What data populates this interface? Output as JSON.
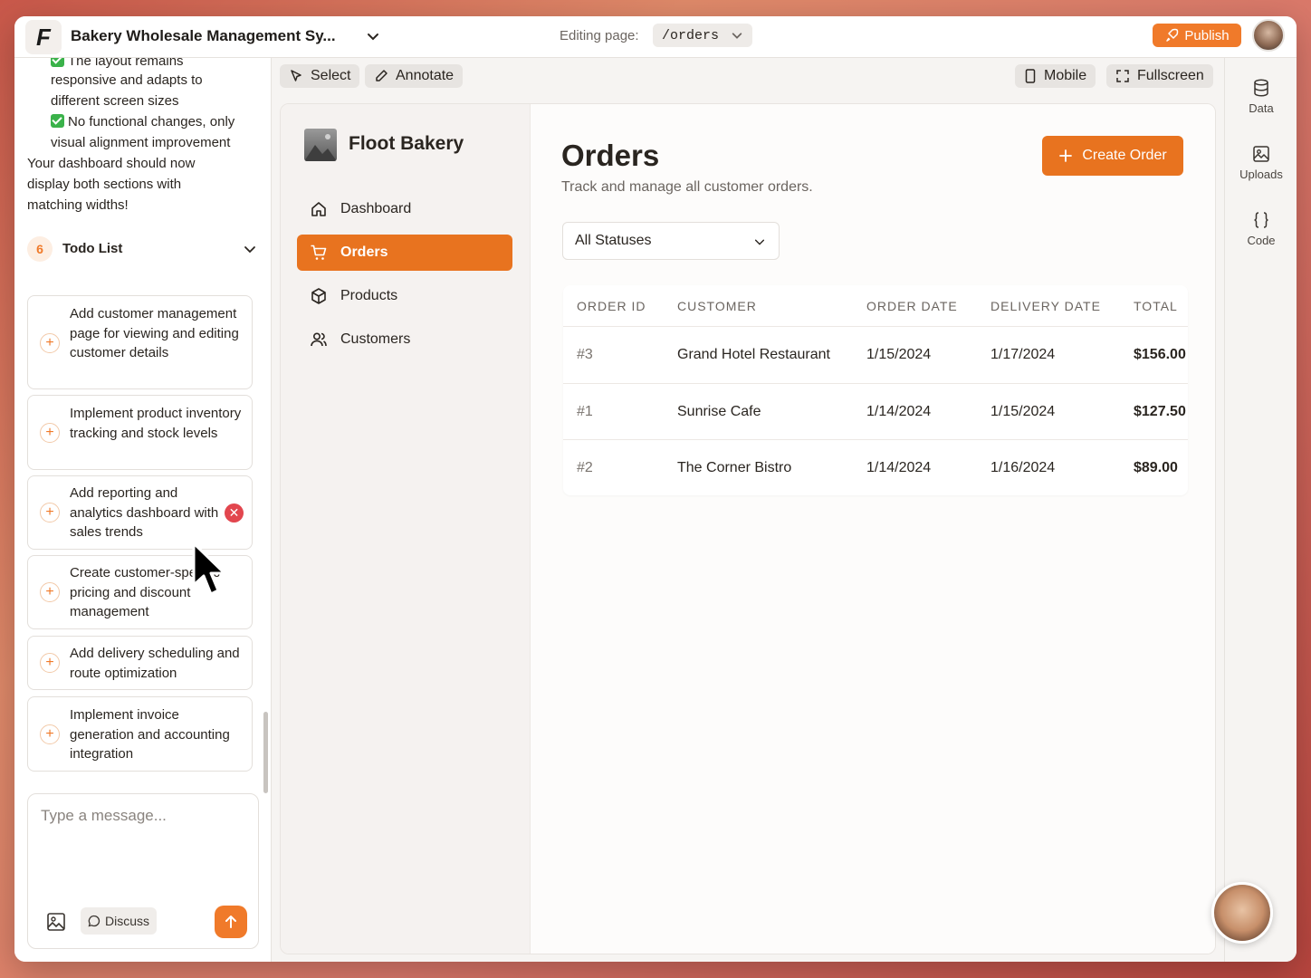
{
  "app": {
    "title": "Bakery Wholesale Management Sy...",
    "editing_label": "Editing page:",
    "page_path": "/orders",
    "publish_label": "Publish"
  },
  "chat": {
    "lines": [
      "The layout remains",
      "responsive and adapts to",
      "different screen sizes",
      "No functional changes, only",
      "visual alignment improvement",
      "Your dashboard should now",
      "display both sections with",
      "matching widths!"
    ],
    "todo": {
      "count": "6",
      "title": "Todo List",
      "items": [
        {
          "text": "Add customer management page for viewing and editing customer details"
        },
        {
          "text": "Implement product inventory tracking and stock levels"
        },
        {
          "text": "Add reporting and analytics dashboard with sales trends"
        },
        {
          "text": "Create customer-specific pricing and discount management"
        },
        {
          "text": "Add delivery scheduling and route optimization"
        },
        {
          "text": "Implement invoice generation and accounting integration"
        }
      ]
    },
    "input_placeholder": "Type a message...",
    "discuss_label": "Discuss"
  },
  "toolbar": {
    "select_label": "Select",
    "annotate_label": "Annotate",
    "mobile_label": "Mobile",
    "fullscreen_label": "Fullscreen"
  },
  "preview": {
    "brand": "Floot Bakery",
    "nav": [
      {
        "label": "Dashboard",
        "icon": "home-icon",
        "active": false
      },
      {
        "label": "Orders",
        "icon": "cart-icon",
        "active": true
      },
      {
        "label": "Products",
        "icon": "box-icon",
        "active": false
      },
      {
        "label": "Customers",
        "icon": "users-icon",
        "active": false
      }
    ],
    "page_title": "Orders",
    "page_subtitle": "Track and manage all customer orders.",
    "create_label": "Create Order",
    "status_filter": "All Statuses",
    "table": {
      "headers": [
        "ORDER ID",
        "CUSTOMER",
        "ORDER DATE",
        "DELIVERY DATE",
        "TOTAL"
      ],
      "rows": [
        [
          "#3",
          "Grand Hotel Restaurant",
          "1/15/2024",
          "1/17/2024",
          "$156.00"
        ],
        [
          "#1",
          "Sunrise Cafe",
          "1/14/2024",
          "1/15/2024",
          "$127.50"
        ],
        [
          "#2",
          "The Corner Bistro",
          "1/14/2024",
          "1/16/2024",
          "$89.00"
        ]
      ]
    }
  },
  "rail": {
    "data_label": "Data",
    "uploads_label": "Uploads",
    "code_label": "Code"
  },
  "colors": {
    "accent": "#e8731f",
    "publish": "#f07a2a",
    "check": "#3ab24a",
    "remove": "#e2464e"
  }
}
